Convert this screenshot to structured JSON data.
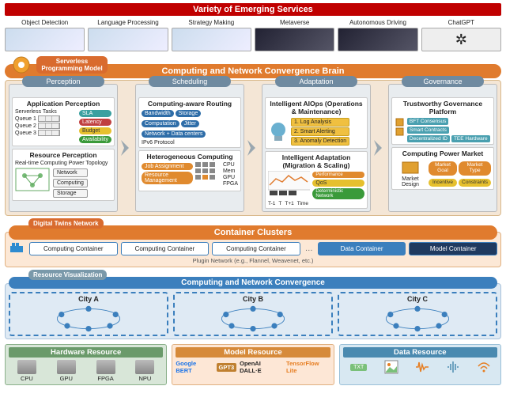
{
  "top_banner": "Variety of Emerging Services",
  "services": [
    {
      "label": "Object Detection",
      "style": "light"
    },
    {
      "label": "Language Processing",
      "style": "light"
    },
    {
      "label": "Strategy Making",
      "style": "light"
    },
    {
      "label": "Metaverse",
      "style": "dark"
    },
    {
      "label": "Autonomous Driving",
      "style": "dark"
    },
    {
      "label": "ChatGPT",
      "style": "chat"
    }
  ],
  "tags": {
    "serverless": "Serverless Programming Model",
    "digital_twins": "Digital Twins Network",
    "resource_vis": "Resource Visualization"
  },
  "brain_banner": "Computing and Network Convergence Brain",
  "columns": {
    "perception": {
      "head": "Perception",
      "app": {
        "title": "Application Perception",
        "subtitle": "Serverless Tasks",
        "queues": [
          "Queue 1",
          "Queue 2",
          "Queue 3"
        ],
        "metrics": [
          "SLA",
          "Latency",
          "Budget",
          "Availability"
        ]
      },
      "res": {
        "title": "Resource Perception",
        "subtitle": "Real-time Computing Power Topology",
        "nodes": [
          "Network",
          "Computing",
          "Storage"
        ]
      }
    },
    "scheduling": {
      "head": "Scheduling",
      "routing": {
        "title": "Computing-aware Routing",
        "bubbles": [
          "Bandwidth",
          "Storage",
          "Computation",
          "Jitter",
          "Network + Data centers"
        ],
        "proto": "IPv6 Protocol"
      },
      "hetero": {
        "title": "Heterogeneous Computing",
        "tasks": [
          "Job Assignment",
          "Resource Management"
        ],
        "units": [
          "CPU",
          "Mem",
          "GPU",
          "FPGA"
        ]
      }
    },
    "adaptation": {
      "head": "Adaptation",
      "aiops": {
        "title": "Intelligent AIOps (Operations & Maintenance)",
        "steps": [
          "1. Log Analysis",
          "2. Smart Alerting",
          "3. Anomaly Detection"
        ]
      },
      "adapt": {
        "title": "Intelligent Adaptation (Migration & Scaling)",
        "right": [
          "Performance",
          "QoS",
          "Deterministic Network"
        ],
        "time_axis": [
          "T-1",
          "T",
          "T+1",
          "Time"
        ]
      }
    },
    "governance": {
      "head": "Governance",
      "trust": {
        "title": "Trustworthy Governance Platform",
        "items": [
          "BFT Consensus",
          "Smart Contracts",
          "Decentralized ID",
          "TEE Hardware"
        ]
      },
      "market": {
        "title": "Computing Power Market",
        "left": "Market Design",
        "grid": [
          "Market Goal",
          "Market Type",
          "Incentive",
          "Constraints"
        ]
      }
    }
  },
  "container": {
    "banner": "Container Clusters",
    "items": [
      "Computing Container",
      "Computing Container",
      "Computing Container"
    ],
    "extra": [
      "Data Container",
      "Model Container"
    ],
    "plugin": "Plugin Network (e.g., Flannel, Weavenet, etc.)"
  },
  "convergence": {
    "banner": "Computing and Network Convergence",
    "cities": [
      "City A",
      "City B",
      "City C"
    ]
  },
  "resources": {
    "hw": {
      "head": "Hardware Resource",
      "items": [
        "CPU",
        "GPU",
        "FPGA",
        "NPU"
      ]
    },
    "model": {
      "head": "Model Resource",
      "items": [
        "Google BERT",
        "GPT3",
        "OpenAI DALL·E",
        "TensorFlow Lite"
      ]
    },
    "data": {
      "head": "Data Resource",
      "items": [
        "TXT",
        "image",
        "signal",
        "audio",
        "wifi"
      ]
    }
  }
}
